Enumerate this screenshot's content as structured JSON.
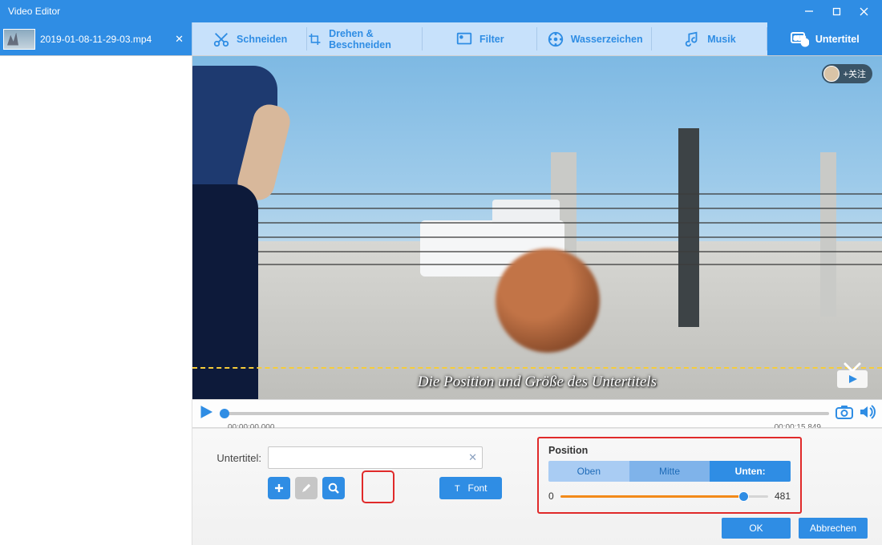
{
  "window": {
    "title": "Video Editor"
  },
  "file": {
    "name": "2019-01-08-11-29-03.mp4"
  },
  "tools": [
    {
      "id": "cut",
      "label": "Schneiden"
    },
    {
      "id": "rotate",
      "label": "Drehen & Beschneiden"
    },
    {
      "id": "filter",
      "label": "Filter"
    },
    {
      "id": "watermark",
      "label": "Wasserzeichen"
    },
    {
      "id": "music",
      "label": "Musik"
    },
    {
      "id": "subtitle",
      "label": "Untertitel"
    }
  ],
  "activeTool": "subtitle",
  "preview": {
    "subtitle_overlay": "Die Position und Größe des Untertitels",
    "follow_label": "+关注"
  },
  "transport": {
    "current": "00:00:00.000",
    "total": "00:00:15.849"
  },
  "subtitle_panel": {
    "field_label": "Untertitel:",
    "input_value": "",
    "font_button": "Font"
  },
  "position_panel": {
    "title": "Position",
    "options": {
      "top": "Oben",
      "middle": "Mitte",
      "bottom": "Unten:"
    },
    "selected": "bottom",
    "slider": {
      "min": "0",
      "value": "481",
      "max": 548
    }
  },
  "footer": {
    "ok": "OK",
    "cancel": "Abbrechen"
  }
}
